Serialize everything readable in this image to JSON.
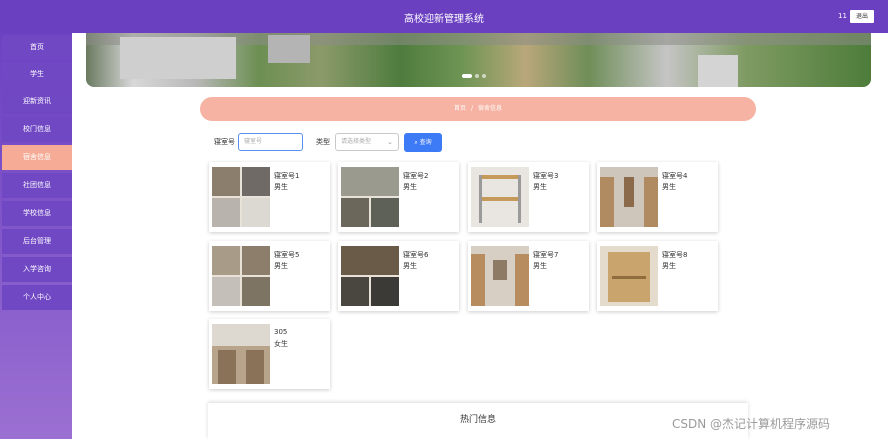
{
  "header": {
    "title": "高校迎新管理系统",
    "username": "11",
    "logout_label": "退出"
  },
  "sidebar": {
    "items": [
      {
        "label": "首页",
        "active": false
      },
      {
        "label": "学生",
        "active": false
      },
      {
        "label": "迎新资讯",
        "active": false
      },
      {
        "label": "校门信息",
        "active": false
      },
      {
        "label": "宿舍信息",
        "active": true
      },
      {
        "label": "社团信息",
        "active": false
      },
      {
        "label": "学校信息",
        "active": false
      },
      {
        "label": "后台管理",
        "active": false
      },
      {
        "label": "入学咨询",
        "active": false
      },
      {
        "label": "个人中心",
        "active": false
      }
    ]
  },
  "breadcrumb": {
    "home": "首页",
    "separator": "/",
    "current": "宿舍信息"
  },
  "search": {
    "room_label": "寝室号",
    "room_placeholder": "寝室号",
    "type_label": "类型",
    "type_placeholder": "请选择类型",
    "button_label": "查询"
  },
  "rooms": [
    {
      "name": "寝室号1",
      "type": "男生"
    },
    {
      "name": "寝室号2",
      "type": "男生"
    },
    {
      "name": "寝室号3",
      "type": "男生"
    },
    {
      "name": "寝室号4",
      "type": "男生"
    },
    {
      "name": "寝室号5",
      "type": "男生"
    },
    {
      "name": "寝室号6",
      "type": "男生"
    },
    {
      "name": "寝室号7",
      "type": "男生"
    },
    {
      "name": "寝室号8",
      "type": "男生"
    },
    {
      "name": "305",
      "type": "女生"
    }
  ],
  "hot_section": {
    "title": "热门信息"
  },
  "watermark": "CSDN @杰记计算机程序源码",
  "colors": {
    "header": "#6a3fc0",
    "sidebar": "#7148c4",
    "active_item": "#f6ab97",
    "breadcrumb": "#f6b2a2",
    "primary_button": "#3d7af5"
  }
}
